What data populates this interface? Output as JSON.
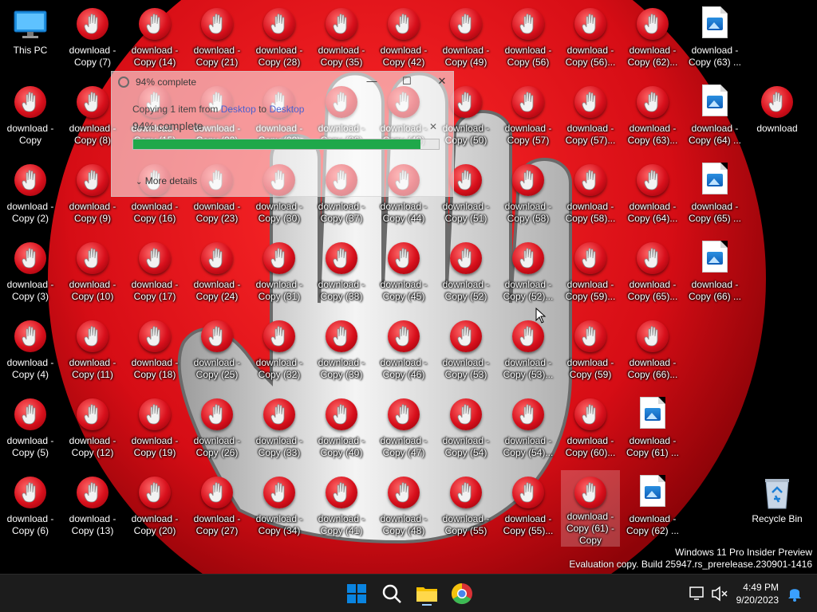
{
  "desktop": {
    "icons": [
      {
        "label": "This PC",
        "type": "pc"
      },
      {
        "label": "download -\nCopy (7)",
        "type": "stop"
      },
      {
        "label": "download -\nCopy (14)",
        "type": "stop"
      },
      {
        "label": "download -\nCopy (21)",
        "type": "stop"
      },
      {
        "label": "download -\nCopy (28)",
        "type": "stop"
      },
      {
        "label": "download -\nCopy (35)",
        "type": "stop"
      },
      {
        "label": "download -\nCopy (42)",
        "type": "stop"
      },
      {
        "label": "download -\nCopy (49)",
        "type": "stop"
      },
      {
        "label": "download -\nCopy (56)",
        "type": "stop"
      },
      {
        "label": "download -\nCopy (56)...",
        "type": "stop"
      },
      {
        "label": "download -\nCopy (62)...",
        "type": "stop"
      },
      {
        "label": "download -\nCopy (63) ...",
        "type": "image"
      },
      {
        "label": "download -\nCopy",
        "type": "stop"
      },
      {
        "label": "download -\nCopy (8)",
        "type": "stop"
      },
      {
        "label": "download -\nCopy (15)",
        "type": "stop"
      },
      {
        "label": "download -\nCopy (22)",
        "type": "stop"
      },
      {
        "label": "download -\nCopy (29)",
        "type": "stop"
      },
      {
        "label": "download -\nCopy (36)",
        "type": "stop"
      },
      {
        "label": "download -\nCopy (43)",
        "type": "stop"
      },
      {
        "label": "download -\nCopy (50)",
        "type": "stop"
      },
      {
        "label": "download -\nCopy (57)",
        "type": "stop"
      },
      {
        "label": "download -\nCopy (57)...",
        "type": "stop"
      },
      {
        "label": "download -\nCopy (63)...",
        "type": "stop"
      },
      {
        "label": "download -\nCopy (64) ...",
        "type": "image"
      },
      {
        "label": "download",
        "type": "stop"
      },
      {
        "label": "download -\nCopy (2)",
        "type": "stop"
      },
      {
        "label": "download -\nCopy (9)",
        "type": "stop"
      },
      {
        "label": "download -\nCopy (16)",
        "type": "stop"
      },
      {
        "label": "download -\nCopy (23)",
        "type": "stop"
      },
      {
        "label": "download -\nCopy (30)",
        "type": "stop"
      },
      {
        "label": "download -\nCopy (37)",
        "type": "stop"
      },
      {
        "label": "download -\nCopy (44)",
        "type": "stop"
      },
      {
        "label": "download -\nCopy (51)",
        "type": "stop"
      },
      {
        "label": "download -\nCopy (58)",
        "type": "stop"
      },
      {
        "label": "download -\nCopy (58)...",
        "type": "stop"
      },
      {
        "label": "download -\nCopy (64)...",
        "type": "stop"
      },
      {
        "label": "download -\nCopy (65) ...",
        "type": "image"
      },
      {
        "label": "download -\nCopy (3)",
        "type": "stop"
      },
      {
        "label": "download -\nCopy (10)",
        "type": "stop"
      },
      {
        "label": "download -\nCopy (17)",
        "type": "stop"
      },
      {
        "label": "download -\nCopy (24)",
        "type": "stop"
      },
      {
        "label": "download -\nCopy (31)",
        "type": "stop"
      },
      {
        "label": "download -\nCopy (38)",
        "type": "stop"
      },
      {
        "label": "download -\nCopy (45)",
        "type": "stop"
      },
      {
        "label": "download -\nCopy (52)",
        "type": "stop"
      },
      {
        "label": "download -\nCopy (52)...",
        "type": "stop"
      },
      {
        "label": "download -\nCopy (59)...",
        "type": "stop"
      },
      {
        "label": "download -\nCopy (65)...",
        "type": "stop"
      },
      {
        "label": "download -\nCopy (66) ...",
        "type": "image"
      },
      {
        "label": "download -\nCopy (4)",
        "type": "stop"
      },
      {
        "label": "download -\nCopy (11)",
        "type": "stop"
      },
      {
        "label": "download -\nCopy (18)",
        "type": "stop"
      },
      {
        "label": "download -\nCopy (25)",
        "type": "stop"
      },
      {
        "label": "download -\nCopy (32)",
        "type": "stop"
      },
      {
        "label": "download -\nCopy (39)",
        "type": "stop"
      },
      {
        "label": "download -\nCopy (46)",
        "type": "stop"
      },
      {
        "label": "download -\nCopy (53)",
        "type": "stop"
      },
      {
        "label": "download -\nCopy (53)...",
        "type": "stop"
      },
      {
        "label": "download -\nCopy (59)",
        "type": "stop"
      },
      {
        "label": "download -\nCopy (66)...",
        "type": "stop"
      },
      {
        "label": "download -\nCopy (5)",
        "type": "stop"
      },
      {
        "label": "download -\nCopy (12)",
        "type": "stop"
      },
      {
        "label": "download -\nCopy (19)",
        "type": "stop"
      },
      {
        "label": "download -\nCopy (26)",
        "type": "stop"
      },
      {
        "label": "download -\nCopy (33)",
        "type": "stop"
      },
      {
        "label": "download -\nCopy (40)",
        "type": "stop"
      },
      {
        "label": "download -\nCopy (47)",
        "type": "stop"
      },
      {
        "label": "download -\nCopy (54)",
        "type": "stop"
      },
      {
        "label": "download -\nCopy (54)...",
        "type": "stop"
      },
      {
        "label": "download -\nCopy (60)...",
        "type": "stop"
      },
      {
        "label": "download -\nCopy (61) ...",
        "type": "image"
      },
      {
        "label": "download -\nCopy (6)",
        "type": "stop"
      },
      {
        "label": "download -\nCopy (13)",
        "type": "stop"
      },
      {
        "label": "download -\nCopy (20)",
        "type": "stop"
      },
      {
        "label": "download -\nCopy (27)",
        "type": "stop"
      },
      {
        "label": "download -\nCopy (34)",
        "type": "stop"
      },
      {
        "label": "download -\nCopy (41)",
        "type": "stop"
      },
      {
        "label": "download -\nCopy (48)",
        "type": "stop"
      },
      {
        "label": "download -\nCopy (55)",
        "type": "stop"
      },
      {
        "label": "download -\nCopy (55)...",
        "type": "stop"
      },
      {
        "label": "download -\nCopy (61) -\nCopy",
        "type": "stop",
        "selected": true
      },
      {
        "label": "download -\nCopy (62) ...",
        "type": "image"
      },
      {
        "label": "Recycle Bin",
        "type": "bin"
      }
    ]
  },
  "copy_dialog": {
    "title": "94% complete",
    "copy_prefix": "Copying 1 item from ",
    "source": "Desktop",
    "to_word": " to ",
    "destination": "Desktop",
    "percent_text": "94% complete",
    "progress": 0.94,
    "more_details": "More details",
    "close_glyph": "✕",
    "minimize_glyph": "—",
    "maximize_glyph": "☐",
    "cancel_glyph": "✕"
  },
  "watermark": {
    "line1": "Windows 11 Pro Insider Preview",
    "line2": "Evaluation copy. Build 25947.rs_prerelease.230901-1416"
  },
  "taskbar": {
    "time": "4:49 PM",
    "date": "9/20/2023",
    "apps": [
      "start-icon",
      "search-icon",
      "file-explorer-icon",
      "chrome-icon"
    ]
  },
  "colors": {
    "stop_red": "#d8101c",
    "progress_green": "#1fa84a",
    "taskbar_bg": "#1c1c1c",
    "accent_blue": "#0078d4"
  }
}
